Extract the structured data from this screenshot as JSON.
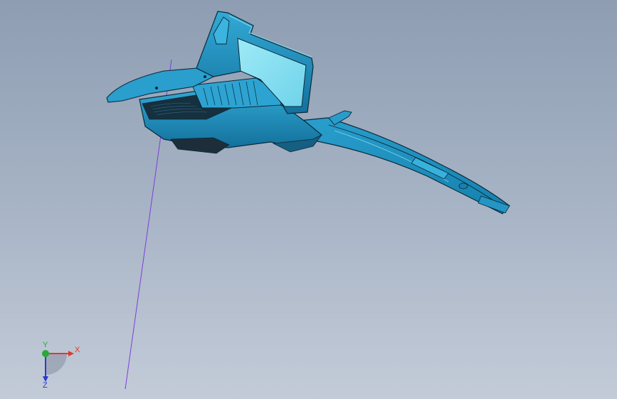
{
  "viewport": {
    "background_top": "#8e9db2",
    "background_bottom": "#c3cbd8"
  },
  "model": {
    "part": "trim-panel",
    "surface_color": "#1f8fc0",
    "edge_color": "#0a2a3a",
    "highlight_color": "#7fd8ee"
  },
  "reference_line": {
    "color": "#7b3fd6"
  },
  "triad": {
    "x_label": "X",
    "y_label": "Y",
    "z_label": "Z",
    "x_color": "#e03a2a",
    "y_color": "#2aa83a",
    "z_color": "#2a3ad0"
  }
}
